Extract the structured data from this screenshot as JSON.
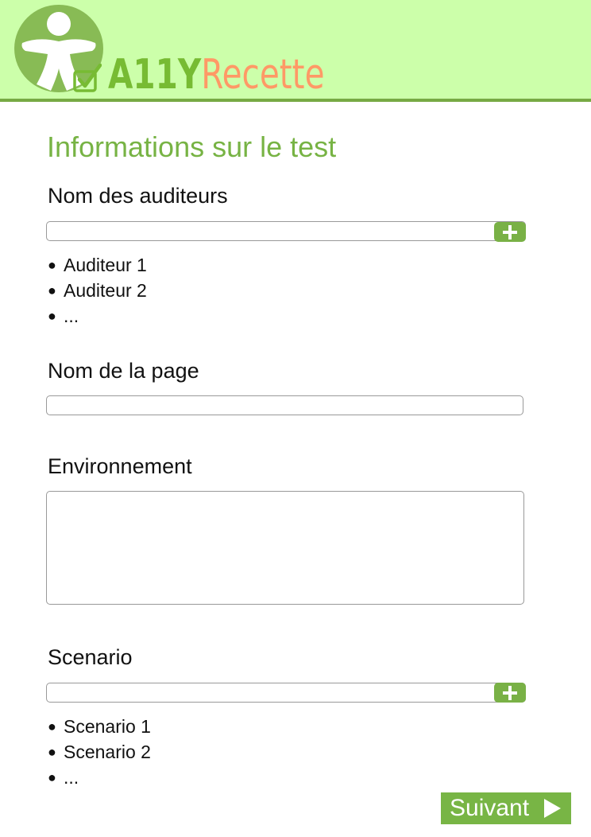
{
  "header": {
    "logo_part1": "A11Y",
    "logo_part2": "Recette"
  },
  "page_title": "Informations sur le test",
  "auditors": {
    "label": "Nom des auditeurs",
    "input_value": "",
    "add_icon": "plus-icon",
    "items": [
      "Auditeur 1",
      "Auditeur 2",
      "..."
    ]
  },
  "page_name": {
    "label": "Nom de la page",
    "input_value": ""
  },
  "environment": {
    "label": "Environnement",
    "value": ""
  },
  "scenario": {
    "label": "Scenario",
    "input_value": "",
    "add_icon": "plus-icon",
    "items": [
      "Scenario 1",
      "Scenario 2",
      "..."
    ]
  },
  "next_button": {
    "label": "Suivant",
    "icon": "play-arrow-icon"
  },
  "colors": {
    "header_bg": "#ccffaa",
    "accent_green": "#79b146",
    "brand_orange": "#ff9966"
  }
}
